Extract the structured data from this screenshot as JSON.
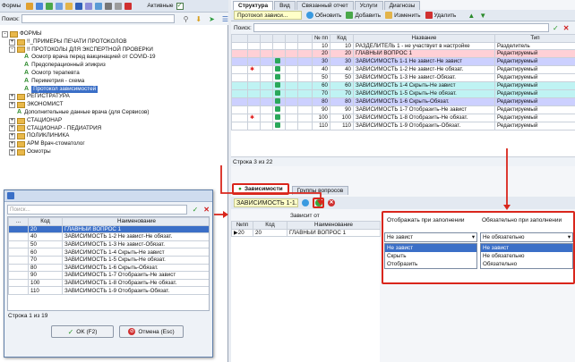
{
  "left": {
    "toolbar_label": "Формы",
    "active_label": "Активные",
    "search_label": "Поиск:",
    "tree": [
      {
        "label": "ФОРМЫ",
        "kind": "folder",
        "pm": "-",
        "indent": 0
      },
      {
        "label": "!!_ПРИМЕРЫ ПЕЧАТИ ПРОТОКОЛОВ",
        "kind": "folder",
        "pm": "+",
        "indent": 1
      },
      {
        "label": "!! ПРОТОКОЛЫ ДЛЯ ЭКСПЕРТНОЙ ПРОВЕРКИ",
        "kind": "folder",
        "pm": "-",
        "indent": 1
      },
      {
        "label": "Осмотр врача перед вакцинацией от COVID-19",
        "kind": "form",
        "indent": 2
      },
      {
        "label": "Предоперационный эпикриз",
        "kind": "form",
        "indent": 2
      },
      {
        "label": "Осмотр терапевта",
        "kind": "form",
        "indent": 2
      },
      {
        "label": "Периметрия - схема",
        "kind": "form",
        "indent": 2
      },
      {
        "label": "Протокол зависимостей",
        "kind": "form",
        "indent": 2,
        "selected": true
      },
      {
        "label": "РЕГИСТРАТУРА",
        "kind": "folder",
        "pm": "+",
        "indent": 1
      },
      {
        "label": "ЭКОНОМИСТ",
        "kind": "folder",
        "pm": "+",
        "indent": 1
      },
      {
        "label": "Дополнительные данные врача (для Сервисов)",
        "kind": "form",
        "indent": 1
      },
      {
        "label": "СТАЦИОНАР",
        "kind": "folder",
        "pm": "+",
        "indent": 1
      },
      {
        "label": "СТАЦИОНАР - ПЕДИАТРИЯ",
        "kind": "folder",
        "pm": "+",
        "indent": 1
      },
      {
        "label": "ПОЛИКЛИНИКА",
        "kind": "folder",
        "pm": "+",
        "indent": 1
      },
      {
        "label": "АРМ Врач-стоматолог",
        "kind": "folder",
        "pm": "+",
        "indent": 1
      },
      {
        "label": "Осмотры",
        "kind": "folder",
        "pm": "+",
        "indent": 1
      }
    ]
  },
  "right": {
    "tabs": [
      "Структура",
      "Вид",
      "Связанный отчет",
      "Услуги",
      "Диагнозы"
    ],
    "toolbar": {
      "doc": "Протокол зависи...",
      "refresh": "Обновить",
      "add": "Добавить",
      "edit": "Изменить",
      "delete": "Удалить"
    },
    "search_label": "Поиск:",
    "headers": [
      "№ пп",
      "Код",
      "Название",
      "Тип"
    ],
    "rows": [
      {
        "n": "10",
        "code": "10",
        "name": "РАЗДЕЛИТЕЛЬ 1 - не участвует в настройке",
        "type": "Разделитель",
        "cls": "r-white",
        "icon": ""
      },
      {
        "n": "20",
        "code": "20",
        "name": "ГЛАВНЫЙ ВОПРОС 1",
        "type": "Редактируемый",
        "cls": "r-pink",
        "icon": ""
      },
      {
        "n": "30",
        "code": "30",
        "name": "ЗАВИСИМОСТЬ 1-1  Не завист-Не завист",
        "type": "Редактируемый",
        "cls": "r-lav",
        "icon": "g"
      },
      {
        "n": "40",
        "code": "40",
        "name": "ЗАВИСИМОСТЬ 1-2  Не завист-Не обязат.",
        "type": "Редактируемый",
        "cls": "r-white",
        "icon": "g",
        "star": true
      },
      {
        "n": "50",
        "code": "50",
        "name": "ЗАВИСИМОСТЬ 1-3  Не завист-Обязат.",
        "type": "Редактируемый",
        "cls": "r-white",
        "icon": "g"
      },
      {
        "n": "60",
        "code": "60",
        "name": "ЗАВИСИМОСТЬ 1-4  Скрыть-Не завист",
        "type": "Редактируемый",
        "cls": "r-cyan",
        "icon": "g"
      },
      {
        "n": "70",
        "code": "70",
        "name": "ЗАВИСИМОСТЬ 1-5  Скрыть-Не обязат.",
        "type": "Редактируемый",
        "cls": "r-cyan",
        "icon": "g"
      },
      {
        "n": "80",
        "code": "80",
        "name": "ЗАВИСИМОСТЬ 1-6  Скрыть-Обязат.",
        "type": "Редактируемый",
        "cls": "r-lav",
        "icon": "g"
      },
      {
        "n": "90",
        "code": "90",
        "name": "ЗАВИСИМОСТЬ 1-7  Отобразить-Не завист",
        "type": "Редактируемый",
        "cls": "r-white",
        "icon": "g"
      },
      {
        "n": "100",
        "code": "100",
        "name": "ЗАВИСИМОСТЬ 1-8  Отобразить-Не обязат.",
        "type": "Редактируемый",
        "cls": "r-white",
        "icon": "g",
        "star": true
      },
      {
        "n": "110",
        "code": "110",
        "name": "ЗАВИСИМОСТЬ 1-9  Отобразить-Обязат.",
        "type": "Редактируемый",
        "cls": "r-white",
        "icon": "g"
      }
    ],
    "status": "Строка 3 из 22",
    "bottom_tabs": [
      "Зависимости",
      "Группы вопросов"
    ],
    "dep_name": "ЗАВИСИМОСТЬ 1-1...",
    "dep_from": "Зависит от",
    "dep_headers": [
      "№пп",
      "Код",
      "Наименование"
    ],
    "dep_row": {
      "n": "20",
      "code": "20",
      "name": "ГЛАВНЫЙ ВОПРОС 1"
    },
    "dd": {
      "col1": "Отображать при заполнении",
      "col2": "Обязательно при заполнении",
      "val1": "Не завист",
      "val2": "Не обязательно",
      "opts1": [
        "Не завист",
        "Скрыть",
        "Отобразить"
      ],
      "opts2": [
        "Не завист",
        "Не обязательно",
        "Обязательно"
      ]
    }
  },
  "dialog": {
    "search_placeholder": "Поиск...",
    "headers": [
      "Код",
      "Наименование"
    ],
    "rows": [
      {
        "code": "20",
        "name": "ГЛАВНЫЙ ВОПРОС 1",
        "selected": true
      },
      {
        "code": "40",
        "name": "ЗАВИСИМОСТЬ 1-2  Не завист-Не обязат."
      },
      {
        "code": "50",
        "name": "ЗАВИСИМОСТЬ 1-3  Не завист-Обязат."
      },
      {
        "code": "60",
        "name": "ЗАВИСИМОСТЬ 1-4  Скрыть-Не завист"
      },
      {
        "code": "70",
        "name": "ЗАВИСИМОСТЬ 1-5  Скрыть-Не обязат."
      },
      {
        "code": "80",
        "name": "ЗАВИСИМОСТЬ 1-6  Скрыть-Обязат."
      },
      {
        "code": "90",
        "name": "ЗАВИСИМОСТЬ 1-7  Отобразить-Не завист"
      },
      {
        "code": "100",
        "name": "ЗАВИСИМОСТЬ 1-8  Отобразить-Не обязат."
      },
      {
        "code": "110",
        "name": "ЗАВИСИМОСТЬ 1-9  Отобразить-Обязат."
      }
    ],
    "status": "Строка 1 из 19",
    "ok": "OK (F2)",
    "cancel": "Отмена (Esc)"
  },
  "colors": {
    "accent": "#3b6fc7",
    "red": "#d9261c",
    "pink": "#ffd0d6",
    "lavender": "#ccd0ff",
    "cyan": "#bff3f3"
  }
}
